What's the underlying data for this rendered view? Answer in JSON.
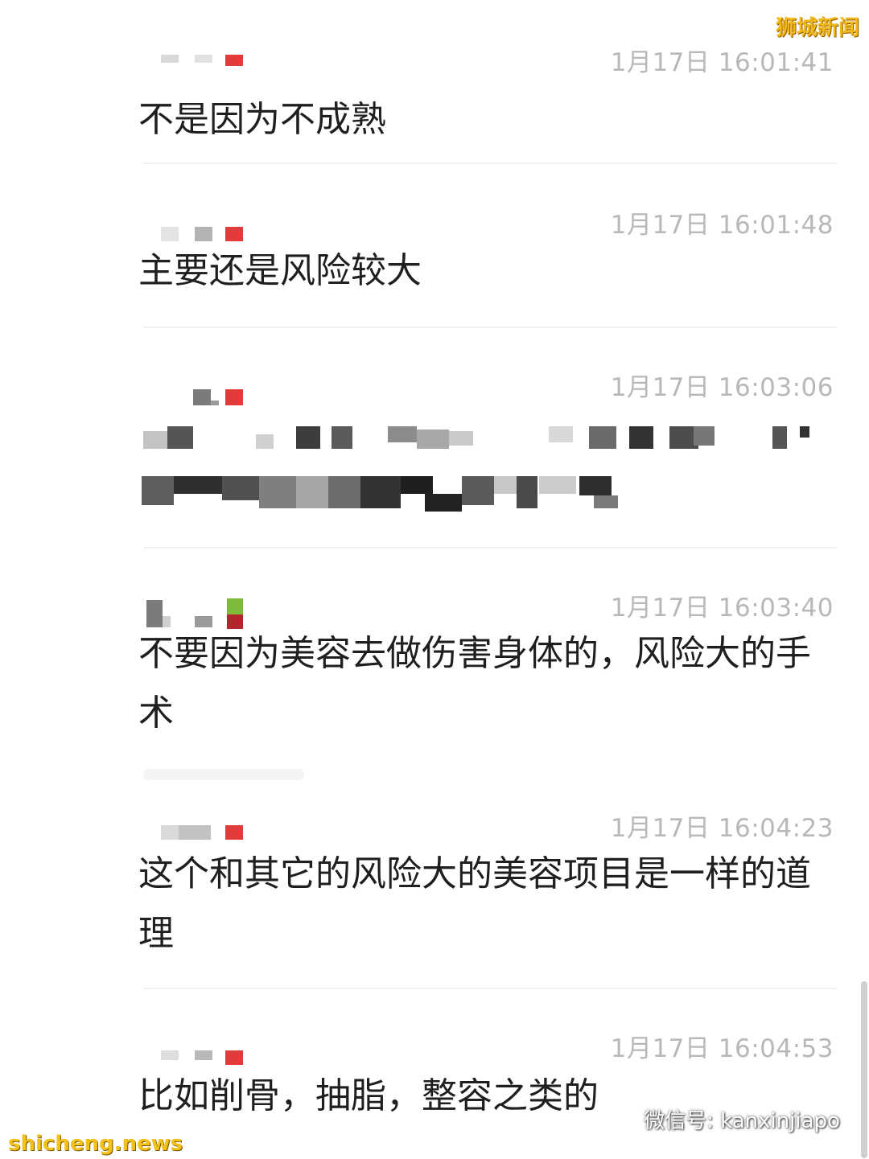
{
  "logo_top_right": "狮城新闻",
  "watermark_bottom_left": "shicheng.news",
  "watermark_wechat": "微信号: kanxinjiapo",
  "colors": {
    "timestamp": "#b8b8b8",
    "text": "#1f1f1f",
    "divider": "#f1f1f1",
    "logo": "#f3b81a"
  },
  "messages": [
    {
      "time": "1月17日 16:01:41",
      "text": "不是因为不成熟"
    },
    {
      "time": "1月17日 16:01:48",
      "text": "主要还是风险较大"
    },
    {
      "time": "1月17日 16:03:06",
      "text": ""
    },
    {
      "time": "1月17日 16:03:40",
      "text": " 不要因为美容去做伤害身体的，风险大的手术"
    },
    {
      "time": "1月17日 16:04:23",
      "text": "这个和其它的风险大的美容项目是一样的道理"
    },
    {
      "time": "1月17日 16:04:53",
      "text": "比如削骨，抽脂，整容之类的"
    }
  ]
}
